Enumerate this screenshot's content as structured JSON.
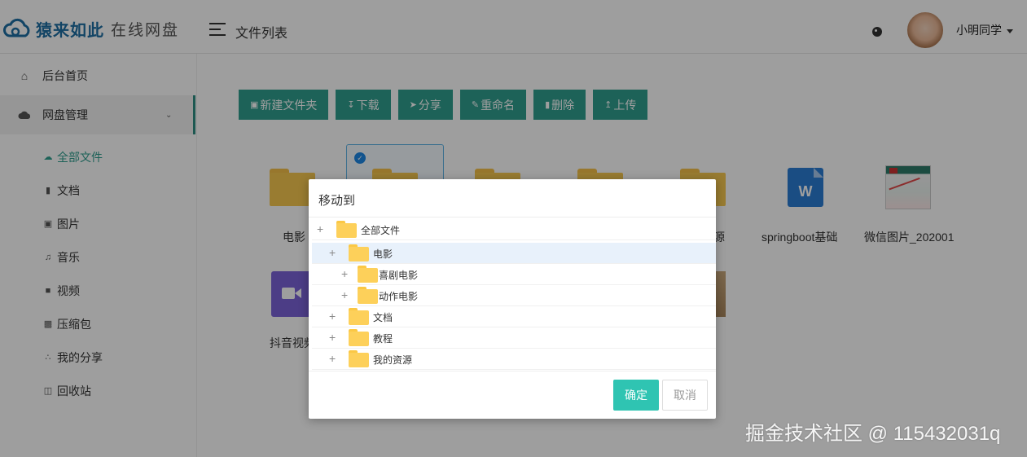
{
  "header": {
    "brand": "猿来如此",
    "brand_sub": "在线网盘",
    "title": "文件列表",
    "user_name": "小明同学"
  },
  "sidebar": {
    "items": [
      {
        "label": "后台首页",
        "icon": "home-icon"
      },
      {
        "label": "网盘管理",
        "icon": "cloud-icon"
      }
    ],
    "sub_items": [
      {
        "label": "全部文件",
        "icon": "cloud-small-icon",
        "active": true
      },
      {
        "label": "文档",
        "icon": "document-icon"
      },
      {
        "label": "图片",
        "icon": "image-icon"
      },
      {
        "label": "音乐",
        "icon": "music-icon"
      },
      {
        "label": "视频",
        "icon": "video-icon"
      },
      {
        "label": "压缩包",
        "icon": "archive-icon"
      },
      {
        "label": "我的分享",
        "icon": "share-icon"
      },
      {
        "label": "回收站",
        "icon": "trash-icon"
      }
    ]
  },
  "toolbar": {
    "new_folder": "新建文件夹",
    "download": "下载",
    "share": "分享",
    "rename": "重命名",
    "delete": "删除",
    "upload": "上传"
  },
  "files": {
    "f0": "电影",
    "f5": "源",
    "f6": "springboot基础",
    "f7": "微信图片_202001",
    "f8": "抖音视频"
  },
  "dialog": {
    "title": "移动到",
    "tree": [
      {
        "label": "全部文件",
        "level": 0
      },
      {
        "label": "电影",
        "level": 1,
        "selected": true
      },
      {
        "label": "喜剧电影",
        "level": 2
      },
      {
        "label": "动作电影",
        "level": 2
      },
      {
        "label": "文档",
        "level": 1
      },
      {
        "label": "教程",
        "level": 1
      },
      {
        "label": "我的资源",
        "level": 1
      }
    ],
    "ok": "确定",
    "cancel": "取消"
  },
  "watermark": "掘金技术社区 @ 115432031q",
  "colors": {
    "accent": "#2f9e8f",
    "ok_button": "#2fc4b2",
    "folder": "#f7c94f"
  }
}
